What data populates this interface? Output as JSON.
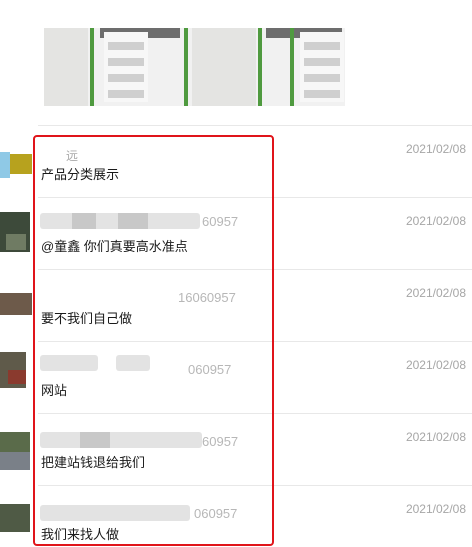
{
  "messages": [
    {
      "sender": "远",
      "id_suffix": "",
      "time": "2021/02/08",
      "text": "产品分类展示"
    },
    {
      "sender": "",
      "id_suffix": "60957",
      "time": "2021/02/08",
      "text": "@童鑫 你们真要高水准点"
    },
    {
      "sender": "",
      "id_suffix": "16060957",
      "time": "2021/02/08",
      "text": "要不我们自己做"
    },
    {
      "sender": "",
      "id_suffix": "060957",
      "time": "2021/02/08",
      "text": "网站"
    },
    {
      "sender": "",
      "id_suffix": "60957",
      "time": "2021/02/08",
      "text": "把建站钱退给我们"
    },
    {
      "sender": "",
      "id_suffix": "060957",
      "time": "2021/02/08",
      "text": "我们来找人做"
    }
  ],
  "colors": {
    "highlight": "#e0141a",
    "banner_stripe": "#4f9a3f"
  }
}
